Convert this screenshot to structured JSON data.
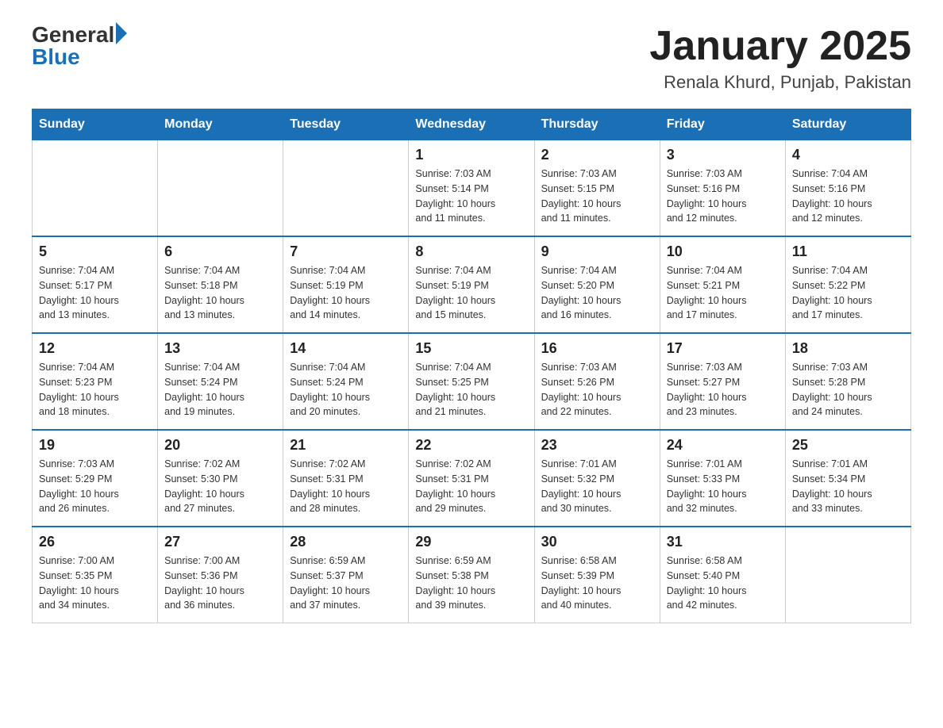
{
  "header": {
    "logo_general": "General",
    "logo_blue": "Blue",
    "title": "January 2025",
    "subtitle": "Renala Khurd, Punjab, Pakistan"
  },
  "weekdays": [
    "Sunday",
    "Monday",
    "Tuesday",
    "Wednesday",
    "Thursday",
    "Friday",
    "Saturday"
  ],
  "weeks": [
    [
      {
        "day": "",
        "info": ""
      },
      {
        "day": "",
        "info": ""
      },
      {
        "day": "",
        "info": ""
      },
      {
        "day": "1",
        "info": "Sunrise: 7:03 AM\nSunset: 5:14 PM\nDaylight: 10 hours\nand 11 minutes."
      },
      {
        "day": "2",
        "info": "Sunrise: 7:03 AM\nSunset: 5:15 PM\nDaylight: 10 hours\nand 11 minutes."
      },
      {
        "day": "3",
        "info": "Sunrise: 7:03 AM\nSunset: 5:16 PM\nDaylight: 10 hours\nand 12 minutes."
      },
      {
        "day": "4",
        "info": "Sunrise: 7:04 AM\nSunset: 5:16 PM\nDaylight: 10 hours\nand 12 minutes."
      }
    ],
    [
      {
        "day": "5",
        "info": "Sunrise: 7:04 AM\nSunset: 5:17 PM\nDaylight: 10 hours\nand 13 minutes."
      },
      {
        "day": "6",
        "info": "Sunrise: 7:04 AM\nSunset: 5:18 PM\nDaylight: 10 hours\nand 13 minutes."
      },
      {
        "day": "7",
        "info": "Sunrise: 7:04 AM\nSunset: 5:19 PM\nDaylight: 10 hours\nand 14 minutes."
      },
      {
        "day": "8",
        "info": "Sunrise: 7:04 AM\nSunset: 5:19 PM\nDaylight: 10 hours\nand 15 minutes."
      },
      {
        "day": "9",
        "info": "Sunrise: 7:04 AM\nSunset: 5:20 PM\nDaylight: 10 hours\nand 16 minutes."
      },
      {
        "day": "10",
        "info": "Sunrise: 7:04 AM\nSunset: 5:21 PM\nDaylight: 10 hours\nand 17 minutes."
      },
      {
        "day": "11",
        "info": "Sunrise: 7:04 AM\nSunset: 5:22 PM\nDaylight: 10 hours\nand 17 minutes."
      }
    ],
    [
      {
        "day": "12",
        "info": "Sunrise: 7:04 AM\nSunset: 5:23 PM\nDaylight: 10 hours\nand 18 minutes."
      },
      {
        "day": "13",
        "info": "Sunrise: 7:04 AM\nSunset: 5:24 PM\nDaylight: 10 hours\nand 19 minutes."
      },
      {
        "day": "14",
        "info": "Sunrise: 7:04 AM\nSunset: 5:24 PM\nDaylight: 10 hours\nand 20 minutes."
      },
      {
        "day": "15",
        "info": "Sunrise: 7:04 AM\nSunset: 5:25 PM\nDaylight: 10 hours\nand 21 minutes."
      },
      {
        "day": "16",
        "info": "Sunrise: 7:03 AM\nSunset: 5:26 PM\nDaylight: 10 hours\nand 22 minutes."
      },
      {
        "day": "17",
        "info": "Sunrise: 7:03 AM\nSunset: 5:27 PM\nDaylight: 10 hours\nand 23 minutes."
      },
      {
        "day": "18",
        "info": "Sunrise: 7:03 AM\nSunset: 5:28 PM\nDaylight: 10 hours\nand 24 minutes."
      }
    ],
    [
      {
        "day": "19",
        "info": "Sunrise: 7:03 AM\nSunset: 5:29 PM\nDaylight: 10 hours\nand 26 minutes."
      },
      {
        "day": "20",
        "info": "Sunrise: 7:02 AM\nSunset: 5:30 PM\nDaylight: 10 hours\nand 27 minutes."
      },
      {
        "day": "21",
        "info": "Sunrise: 7:02 AM\nSunset: 5:31 PM\nDaylight: 10 hours\nand 28 minutes."
      },
      {
        "day": "22",
        "info": "Sunrise: 7:02 AM\nSunset: 5:31 PM\nDaylight: 10 hours\nand 29 minutes."
      },
      {
        "day": "23",
        "info": "Sunrise: 7:01 AM\nSunset: 5:32 PM\nDaylight: 10 hours\nand 30 minutes."
      },
      {
        "day": "24",
        "info": "Sunrise: 7:01 AM\nSunset: 5:33 PM\nDaylight: 10 hours\nand 32 minutes."
      },
      {
        "day": "25",
        "info": "Sunrise: 7:01 AM\nSunset: 5:34 PM\nDaylight: 10 hours\nand 33 minutes."
      }
    ],
    [
      {
        "day": "26",
        "info": "Sunrise: 7:00 AM\nSunset: 5:35 PM\nDaylight: 10 hours\nand 34 minutes."
      },
      {
        "day": "27",
        "info": "Sunrise: 7:00 AM\nSunset: 5:36 PM\nDaylight: 10 hours\nand 36 minutes."
      },
      {
        "day": "28",
        "info": "Sunrise: 6:59 AM\nSunset: 5:37 PM\nDaylight: 10 hours\nand 37 minutes."
      },
      {
        "day": "29",
        "info": "Sunrise: 6:59 AM\nSunset: 5:38 PM\nDaylight: 10 hours\nand 39 minutes."
      },
      {
        "day": "30",
        "info": "Sunrise: 6:58 AM\nSunset: 5:39 PM\nDaylight: 10 hours\nand 40 minutes."
      },
      {
        "day": "31",
        "info": "Sunrise: 6:58 AM\nSunset: 5:40 PM\nDaylight: 10 hours\nand 42 minutes."
      },
      {
        "day": "",
        "info": ""
      }
    ]
  ]
}
